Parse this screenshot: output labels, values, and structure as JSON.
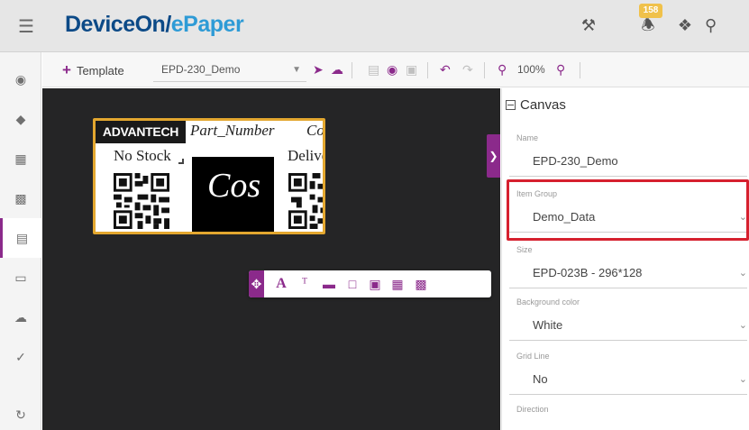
{
  "app": {
    "brand_part1": "DeviceOn/",
    "brand_part2": "ePaper",
    "notification_count": "158"
  },
  "icons": {
    "menu": "hamburger-icon",
    "tools": "hammer-icon",
    "notifications": "bell-icon",
    "help": "help-circle-icon",
    "user": "user-icon"
  },
  "sidebar": {
    "items": [
      {
        "icon": "dashboard-icon"
      },
      {
        "icon": "tag-icon"
      },
      {
        "icon": "table-icon"
      },
      {
        "icon": "image-icon"
      },
      {
        "icon": "template-icon",
        "active": true
      },
      {
        "icon": "monitor-icon"
      },
      {
        "icon": "cloud-icon"
      },
      {
        "icon": "wand-icon"
      },
      {
        "icon": "sync-icon"
      }
    ]
  },
  "toolbar": {
    "add_template_label": "Template",
    "template_selected": "EPD-230_Demo",
    "zoom_level": "100%"
  },
  "epaper": {
    "logo": "ADVANTECH",
    "part_number": "Part_Number",
    "cost": "Cost",
    "no_stock": "No Stock",
    "deliver": "Deliver",
    "big_text": "Cos"
  },
  "properties": {
    "title": "Canvas",
    "fields": [
      {
        "label": "Name",
        "value": "EPD-230_Demo",
        "type": "input"
      },
      {
        "label": "Item Group",
        "value": "Demo_Data",
        "type": "select"
      },
      {
        "label": "Size",
        "value": "EPD-023B - 296*128",
        "type": "select"
      },
      {
        "label": "Background color",
        "value": "White",
        "type": "select"
      },
      {
        "label": "Grid Line",
        "value": "No",
        "type": "select"
      },
      {
        "label": "Direction",
        "value": "",
        "type": "select"
      }
    ]
  },
  "colors": {
    "accent": "#8b2a8b",
    "brand_dark": "#0c4a87",
    "brand_light": "#2e9bd6",
    "canvas_bg": "#252526",
    "highlight": "#d6202e",
    "epaper_border": "#e3a72f"
  }
}
